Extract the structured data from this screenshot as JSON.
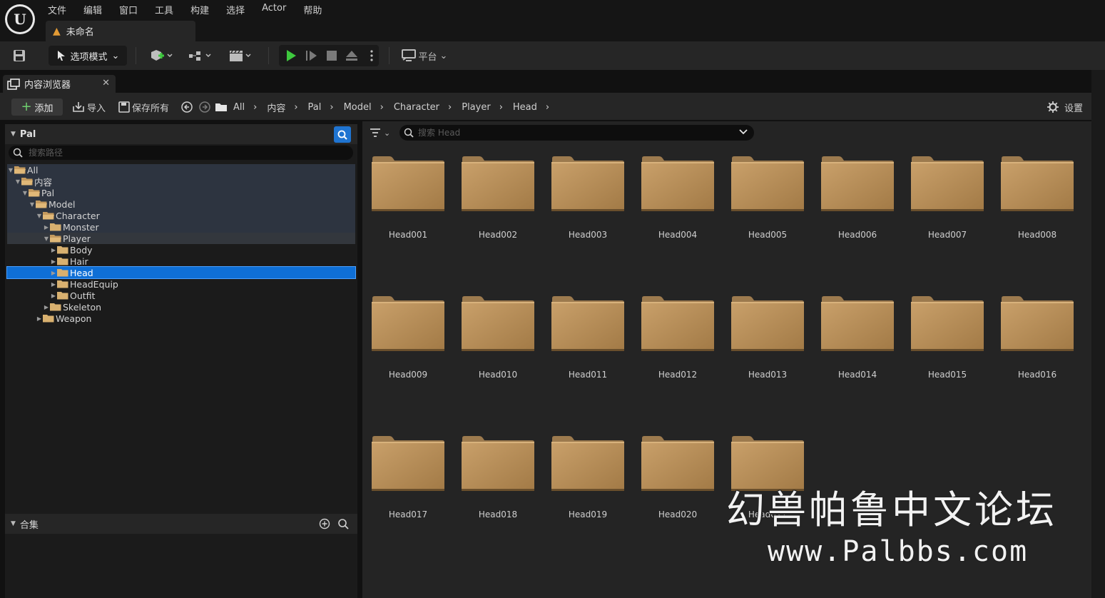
{
  "app": {
    "logo_text": "U",
    "menu": [
      "文件",
      "编辑",
      "窗口",
      "工具",
      "构建",
      "选择",
      "Actor",
      "帮助"
    ],
    "document_tab": "未命名"
  },
  "toolbar": {
    "mode_label": "选项模式",
    "platform_label": "平台"
  },
  "content_browser": {
    "tab_title": "内容浏览器",
    "add_label": "添加",
    "import_label": "导入",
    "save_all_label": "保存所有",
    "breadcrumb": [
      "All",
      "内容",
      "Pal",
      "Model",
      "Character",
      "Player",
      "Head"
    ],
    "settings_label": "设置",
    "sources_title": "Pal",
    "path_search_placeholder": "搜索路径",
    "tree": [
      {
        "label": "All",
        "depth": 0,
        "expanded": true,
        "shaded": true
      },
      {
        "label": "内容",
        "depth": 1,
        "expanded": true,
        "shaded": true
      },
      {
        "label": "Pal",
        "depth": 2,
        "expanded": true,
        "shaded": true
      },
      {
        "label": "Model",
        "depth": 3,
        "expanded": true,
        "shaded": true
      },
      {
        "label": "Character",
        "depth": 4,
        "expanded": true,
        "shaded": true
      },
      {
        "label": "Monster",
        "depth": 5,
        "expanded": false,
        "shaded": true
      },
      {
        "label": "Player",
        "depth": 5,
        "expanded": true,
        "shaded": false,
        "player": true
      },
      {
        "label": "Body",
        "depth": 6,
        "expanded": false
      },
      {
        "label": "Hair",
        "depth": 6,
        "expanded": false
      },
      {
        "label": "Head",
        "depth": 6,
        "expanded": false,
        "selected": true
      },
      {
        "label": "HeadEquip",
        "depth": 6,
        "expanded": false
      },
      {
        "label": "Outfit",
        "depth": 6,
        "expanded": false
      },
      {
        "label": "Skeleton",
        "depth": 5,
        "expanded": false
      },
      {
        "label": "Weapon",
        "depth": 4,
        "expanded": false
      }
    ],
    "collections_title": "合集",
    "asset_search_placeholder": "搜索 Head",
    "assets": [
      "Head001",
      "Head002",
      "Head003",
      "Head004",
      "Head005",
      "Head006",
      "Head007",
      "Head008",
      "Head009",
      "Head010",
      "Head011",
      "Head012",
      "Head013",
      "Head014",
      "Head015",
      "Head016",
      "Head017",
      "Head018",
      "Head019",
      "Head020",
      "Head021"
    ]
  },
  "watermark": {
    "line1": "幻兽帕鲁中文论坛",
    "line2": "www.Palbbs.com"
  },
  "colors": {
    "accent": "#0f6fd6",
    "folder": "#b8905b",
    "play_green": "#3ec93e"
  }
}
